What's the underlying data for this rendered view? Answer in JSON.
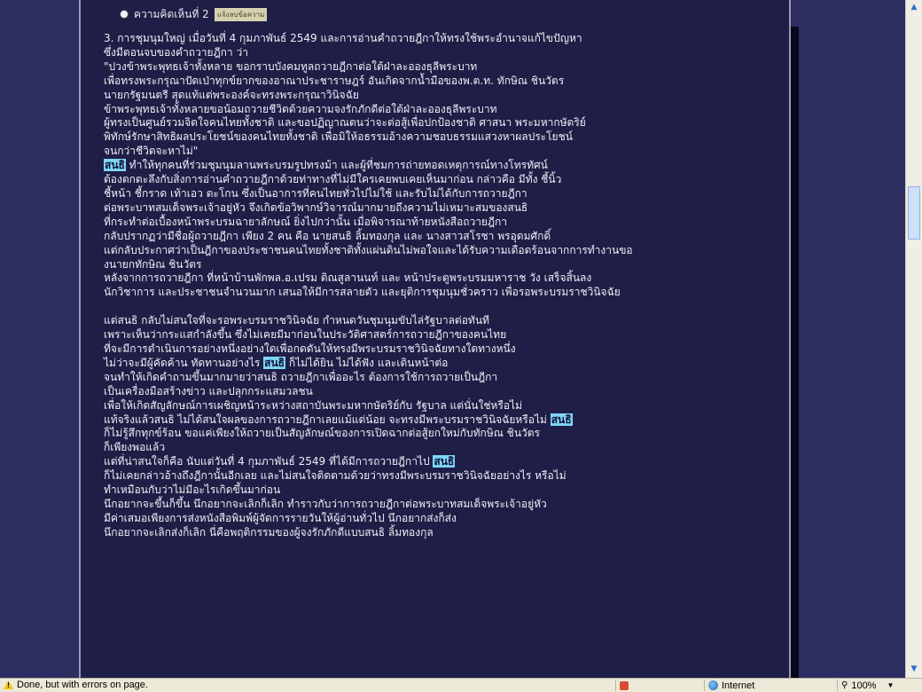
{
  "post": {
    "header": "ความคิดเห็นที่ 2",
    "header_tag": "แจ้งลบข้อความ",
    "paragraph1": [
      "3. การชุมนุมใหญ่ เมื่อวันที่ 4 กุมภาพันธ์ 2549 และการอ่านคำถวายฎีกาให้ทรงใช้พระอำนาจแก้ไขปัญหา",
      "ซึ่งมีตอนจบของคำถวายฎีกา ว่า",
      "\"ปวงข้าพระพุทธเจ้าทั้งหลาย ขอกราบบังคมทูลถวายฎีกาต่อใต้ฝ่าละอองธุลีพระบาท",
      "เพื่อทรงพระกรุณาปัดเป่าทุกข์ยากของอาณาประชาราษฎร์ อันเกิดจากน้ำมือของพ.ต.ท. ทักษิณ ชินวัตร",
      "นายกรัฐมนตรี สุดแท้แต่พระองค์จะทรงพระกรุณาวินิจฉัย",
      "ข้าพระพุทธเจ้าทั้งหลายขอน้อมถวายชีวิตด้วยความจงรักภักดีต่อใต้ฝ่าละอองธุลีพระบาท",
      "ผู้ทรงเป็นศูนย์รวมจิตใจคนไทยทั้งชาติ และขอปฏิญาณตนว่าจะต่อสู้เพื่อปกป้องชาติ ศาสนา พระมหากษัตริย์",
      "พิทักษ์รักษาสิทธิผลประโยชน์ของคนไทยทั้งชาติ เพื่อมิให้อธรรมอ้างความชอบธรรมแสวงหาผลประโยชน์",
      "จนกว่าชีวิตจะหาไม่\""
    ],
    "highlight_name": "สนธิ",
    "p2_first_rest": " ทำให้ทุกคนที่ร่วมชุมนุมลานพระบรมรูปทรงม้า และผู้ที่ชมการถ่ายทอดเหตุการณ์ทางโทรทัศน์",
    "paragraph2": [
      "ต้องตกตะลึงกับสิ่งการอ่านคำถวายฎีกาด้วยท่าทางที่ไม่มีใครเคยพบเคยเห็นมาก่อน กล่าวคือ มีทั้ง ชี้นิ้ว",
      "ชี้หน้า ชี้กราด เท้าเอว ตะโกน ซึ่งเป็นอาการที่คนไทยทั่วไปไม่ใช้ และรับไม่ได้กับการถวายฎีกา",
      "ต่อพระบาทสมเด็จพระเจ้าอยู่หัว จึงเกิดข้อวิพากษ์วิจารณ์มากมายถึงความไม่เหมาะสมของสนธิ",
      "ที่กระทำต่อเบื้องหน้าพระบรมฉายาลักษณ์ ยิ่งไปกว่านั้น เมื่อพิจารณาท้ายหนังสือถวายฎีกา",
      "กลับปรากฏว่ามีชื่อผู้ถวายฎีกา เพียง 2 คน คือ นายสนธิ ลิ้มทองกุล และ นางสาวสโรชา พรอุดมศักดิ์",
      "แต่กลับประกาศว่าเป็นฎีกาของประชาชนคนไทยทั้งชาติทั้งแผ่นดินไม่พอใจและได้รับความเดือดร้อนจากการทำงานขอ",
      "งนายกทักษิณ ชินวัตร",
      "หลังจากการถวายฎีกา ที่หน้าบ้านพักพล.อ.เปรม ติณสูลานนท์ และ หน้าประตูพระบรมมหาราช วัง เสร็จสิ้นลง",
      "นักวิชาการ และประชาชนจำนวนมาก เสนอให้มีการสลายตัว และยุติการชุมนุมชั่วคราว เพื่อรอพระบรมราชวินิจฉัย"
    ],
    "p3_a": [
      "แต่สนธิ กลับไม่สนใจที่จะรอพระบรมราชวินิจฉัย กำหนดวันชุมนุมขับไล่รัฐบาลต่อทันที",
      "เพราะเห็นว่ากระแสกำลังขึ้น ซึ่งไม่เคยมีมาก่อนในประวัติศาสตร์การถวายฎีกาของคนไทย",
      "ที่จะมีการดำเนินการอย่างหนึ่งอย่างใดเพื่อกดดันให้ทรงมีพระบรมราชวินิจฉัยทางใดทางหนึ่ง"
    ],
    "p3_hl1_pre": "ไม่ว่าจะมีผู้คัดค้าน ทัดทานอย่างไร ",
    "p3_hl1_post": " ก็ไม่ได้ยิน ไม่ได้ฟัง และเดินหน้าต่อ",
    "p3_b": [
      "จนทำให้เกิดคำถามขึ้นมากมายว่าสนธิ ถวายฎีกาเพื่ออะไร ต้องการใช้การถวายเป็นฎีกา",
      "เป็นเครื่องมือสร้างข่าว และปลุกกระแสมวลชน",
      "เพื่อให้เกิดสัญลักษณ์การเผชิญหน้าระหว่างสถาบันพระมหากษัตริย์กับ รัฐบาล แต่นั่นใช่หรือไม่"
    ],
    "p3_hl2_pre": "แท้จริงแล้วสนธิ ไม่ได้สนใจผลของการถวายฎีกาเลยแม้แต่น้อย จะทรงมีพระบรมราชวินิจฉัยหรือไม่ ",
    "p3_c": [
      "ก็ไม่รู้สึกทุกข์ร้อน ขอแค่เพียงให้ถวายเป็นสัญลักษณ์ของการเปิดฉากต่อสู้ยกใหม่กับทักษิณ ชินวัตร",
      "ก็เพียงพอแล้ว"
    ],
    "p3_hl3_pre": "แต่ที่น่าสนใจก็คือ นับแต่วันที่ 4 กุมภาพันธ์ 2549 ที่ได้มีการถวายฎีกาไป ",
    "p3_d": [
      "ก็ไม่เคยกล่าวอ้างถึงฎีกานั้นอีกเลย และไม่สนใจติดตามด้วยว่าทรงมีพระบรมราชวินิจฉัยอย่างไร หรือไม่",
      "ทำเหมือนกับว่าไม่มีอะไรเกิดขึ้นมาก่อน",
      "นึกอยากจะขึ้นก็ขึ้น นึกอยากจะเลิกก็เลิก ทำราวกับว่าการถวายฎีกาต่อพระบาทสมเด็จพระเจ้าอยู่หัว",
      "มีค่าเสมอเพียงการส่งหนังสือพิมพ์ผู้จัดการรายวันให้ผู้อ่านทั่วไป นึกอยากส่งก็ส่ง",
      "นึกอยากจะเลิกส่งก็เลิก นี่คือพฤติกรรมของผู้จงรักภักดีแบบสนธิ ลิ้มทองกุล"
    ]
  },
  "status_bar": {
    "message": "Done, but with errors on page.",
    "zone": "Internet",
    "zoom": "100%"
  }
}
